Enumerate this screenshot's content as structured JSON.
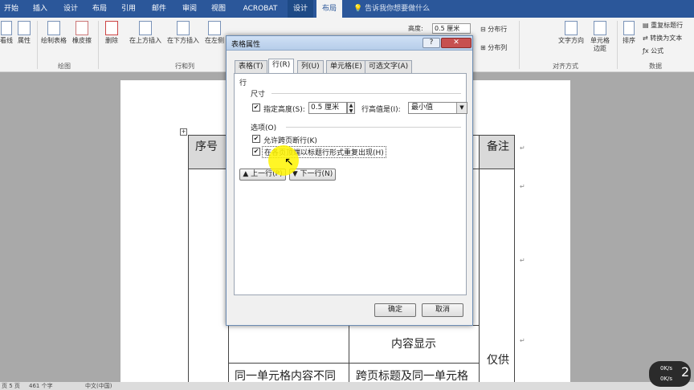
{
  "menubar": {
    "tabs": [
      "开始",
      "插入",
      "设计",
      "布局",
      "引用",
      "邮件",
      "审阅",
      "视图",
      "ACROBAT",
      "设计",
      "布局"
    ],
    "active_tab": "布局",
    "tellme": "告诉我你想要做什么"
  },
  "ribbon": {
    "buttons": {
      "view_gridlines": "看线",
      "properties": "属性",
      "draw_table": "绘制表格",
      "eraser": "橡皮擦",
      "delete": "删除",
      "insert_above": "在上方插入",
      "insert_below": "在下方插入",
      "insert_left": "在左侧",
      "height_label": "高度:",
      "height_value": "0.5 厘米",
      "distribute_rows": "分布行",
      "distribute_cols": "分布列",
      "text_direction": "文字方向",
      "cell_margins": "单元格边距",
      "sort": "排序",
      "repeat_header": "重复标题行",
      "convert_to_text": "转换为文本",
      "formula": "公式"
    },
    "groups": {
      "draw": "绘图",
      "rows_cols": "行和列",
      "alignment": "对齐方式",
      "data": "数据"
    }
  },
  "document": {
    "headers": {
      "seq": "序号",
      "notes": "备注"
    },
    "cells": {
      "content_show": "内容显示",
      "only_for": "仅供",
      "same_cell": "同一单元格内容不同",
      "cross_page": "跨页标题及同一单元格"
    }
  },
  "dialog": {
    "title": "表格属性",
    "help": "?",
    "close": "✕",
    "tabs": [
      "表格(T)",
      "行(R)",
      "列(U)",
      "单元格(E)",
      "可选文字(A)"
    ],
    "active_tab": "行(R)",
    "row_label": "行",
    "size_label": "尺寸",
    "specify_height": "指定高度(S):",
    "height_value": "0.5 厘米",
    "row_height_is": "行高值是(I):",
    "row_height_mode": "最小值",
    "options_label": "选项(O)",
    "allow_break": "允许跨页断行(K)",
    "repeat_header": "在各页顶端以标题行形式重复出现(H)",
    "prev_row": "▲ 上一行(P)",
    "next_row": "▼ 下一行(N)",
    "ok": "确定",
    "cancel": "取消"
  },
  "status": {
    "page": "页 5 页",
    "words": "461 个字",
    "lang": "中文(中国)"
  },
  "network": {
    "up": "0K/s",
    "down": "0K/s",
    "badge": "2"
  }
}
